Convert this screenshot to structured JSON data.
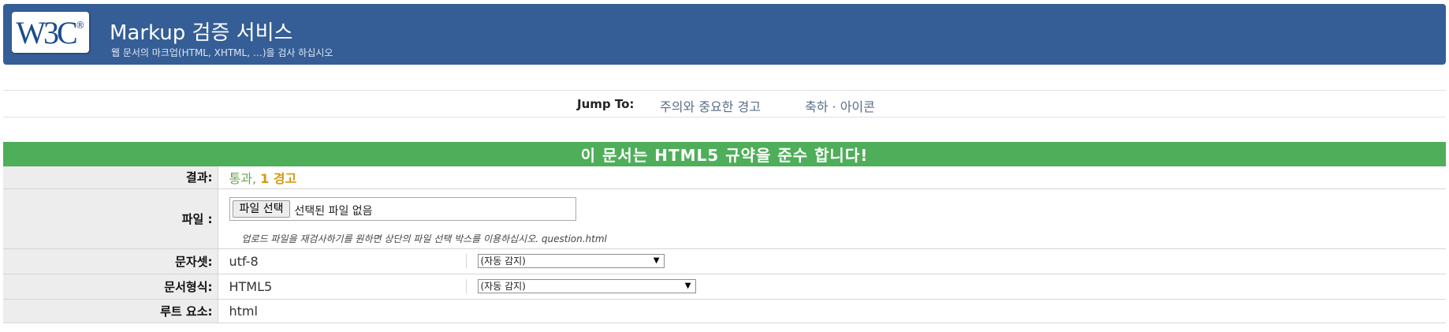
{
  "banner": {
    "logo_text": "W3C",
    "title": "Markup 검증 서비스",
    "subtitle": "웹 문서의 마크업(HTML, XHTML, …)을 검사 하십시오",
    "background_color": "#355e96"
  },
  "jump": {
    "label": "Jump To:",
    "links": [
      {
        "label": "주의와 중요한 경고"
      },
      {
        "label": "축하 · 아이콘"
      }
    ]
  },
  "result": {
    "status_text": "이 문서는 HTML5 규약을 준수 합니다!",
    "status_color": "#4fae59",
    "rows": {
      "result": {
        "label": "결과:",
        "pass_text": "통과,",
        "warn_text": "1 경고"
      },
      "file": {
        "label": "파일 :",
        "button_label": "파일 선택",
        "status": "선택된 파일 없음",
        "note": "업로드 파일을 재검사하기를 원하면 상단의 파일 선택 박스를 이용하십시오. question.html"
      },
      "charset": {
        "label": "문자셋:",
        "value": "utf-8",
        "select_value": "(자동 감지)"
      },
      "doctype": {
        "label": "문서형식:",
        "value": "HTML5",
        "select_value": "(자동 감지)"
      },
      "root": {
        "label": "루트 요소:",
        "value": "html"
      }
    }
  },
  "icons": {
    "select_arrow": "triangle-down-icon"
  }
}
